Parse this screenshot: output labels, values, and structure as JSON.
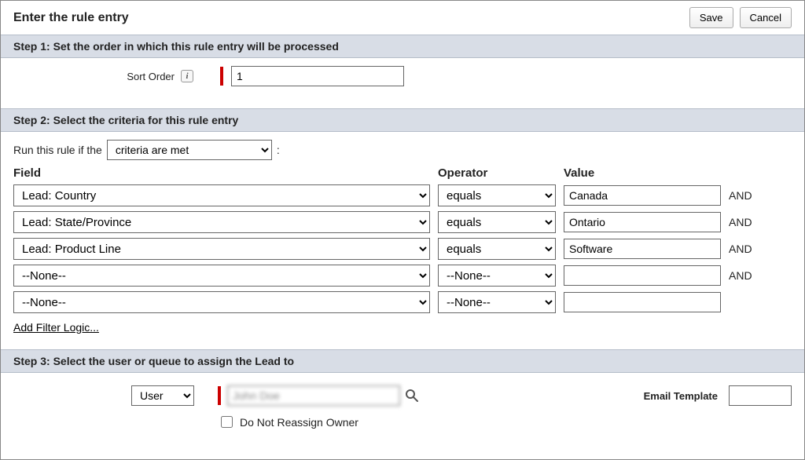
{
  "header": {
    "title": "Enter the rule entry",
    "save_label": "Save",
    "cancel_label": "Cancel"
  },
  "step1": {
    "title": "Step 1: Set the order in which this rule entry will be processed",
    "sort_order_label": "Sort Order",
    "sort_order_value": "1"
  },
  "step2": {
    "title": "Step 2: Select the criteria for this rule entry",
    "run_rule_prefix": "Run this rule if the",
    "run_rule_selected": "criteria are met",
    "run_rule_suffix": ":",
    "headers": {
      "field": "Field",
      "operator": "Operator",
      "value": "Value"
    },
    "and_label": "AND",
    "rows": [
      {
        "field": "Lead: Country",
        "operator": "equals",
        "value": "Canada",
        "and": true
      },
      {
        "field": "Lead: State/Province",
        "operator": "equals",
        "value": "Ontario",
        "and": true
      },
      {
        "field": "Lead: Product Line",
        "operator": "equals",
        "value": "Software",
        "and": true
      },
      {
        "field": "--None--",
        "operator": "--None--",
        "value": "",
        "and": true
      },
      {
        "field": "--None--",
        "operator": "--None--",
        "value": "",
        "and": false
      }
    ],
    "add_filter_logic": "Add Filter Logic..."
  },
  "step3": {
    "title": "Step 3: Select the user or queue to assign the Lead to",
    "assignee_type": "User",
    "assignee_value": "John Doe",
    "do_not_reassign_label": "Do Not Reassign Owner",
    "email_template_label": "Email Template",
    "email_template_value": ""
  }
}
